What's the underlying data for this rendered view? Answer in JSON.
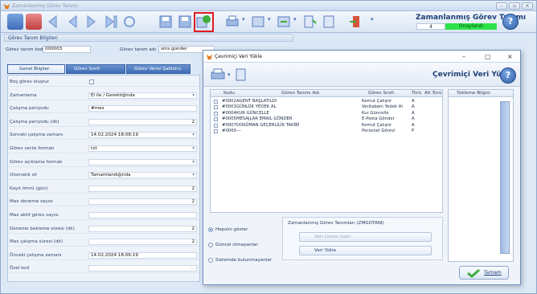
{
  "window": {
    "title": "Zamanlanmış Görev Tanımı",
    "app_title": "Zamanlanmış Görev Tanımı",
    "status_number": "4",
    "status_label": "Onaylandı",
    "help": "?",
    "controls": [
      "minimize-icon",
      "maximize-icon",
      "close-icon"
    ]
  },
  "toolbar": {
    "icons": [
      "first-record-icon",
      "prev-record-icon",
      "prev-icon",
      "next-icon",
      "next-record-icon",
      "last-record-icon",
      "refresh-icon",
      "save-icon",
      "save-as-icon",
      "load-data-icon",
      "print-icon",
      "export-icon",
      "import-icon",
      "attach-icon",
      "exit-icon"
    ]
  },
  "section": {
    "header": "Görev Tanım Bilgileri"
  },
  "header_fields": {
    "code_label": "Görev tanım kodu",
    "code_value": "000003",
    "name_label": "Görev tanım adı",
    "name_value": "sms gonder"
  },
  "tabs": [
    "Genel Bilgiler",
    "Görev Sınıfı Bilgileri",
    "Görev Verisi Şablonu"
  ],
  "form": [
    {
      "label": "Boş görev oluştur",
      "value": "",
      "type": "checkbox"
    },
    {
      "label": "Zamanlama",
      "value": "El ile / Gerektiğinde",
      "type": "select"
    },
    {
      "label": "Çalışma periyodu",
      "value": "#mes",
      "type": "text"
    },
    {
      "label": "Çalışma periyodu (dk)",
      "value": "2",
      "type": "number"
    },
    {
      "label": "Sonraki çalışma zamanı",
      "value": "14.02.2024 18:08:19",
      "type": "select"
    },
    {
      "label": "Görev verisi formatı",
      "value": "txt",
      "type": "select"
    },
    {
      "label": "Görev açıklama formatı",
      "value": "",
      "type": "select"
    },
    {
      "label": "Otomatik sil",
      "value": "Tamamlandığında",
      "type": "select"
    },
    {
      "label": "Kayıt ömrü (gün)",
      "value": "2",
      "type": "number"
    },
    {
      "label": "Max deneme sayısı",
      "value": "2",
      "type": "number"
    },
    {
      "label": "Max aktif görev sayısı",
      "value": "",
      "type": "number"
    },
    {
      "label": "Deneme bekleme süresi (dk)",
      "value": "2",
      "type": "number"
    },
    {
      "label": "Max çalışma süresi (dk)",
      "value": "2",
      "type": "number"
    },
    {
      "label": "Önceki çalışma zamanı",
      "value": "14.02.2024 18:06:19",
      "type": "text"
    },
    {
      "label": "Özel kod",
      "value": "",
      "type": "lookup"
    }
  ],
  "dialog": {
    "title": "Çevrimiçi Veri Yükle",
    "app_title": "Çevrimiçi Veri Yükle",
    "help": "?",
    "controls": [
      "minimize-icon",
      "maximize-icon",
      "close-icon"
    ],
    "columns": [
      "Kodu",
      "Gören Tanımı Adı",
      "Görev Sınıfı",
      "Türü",
      "Alt Türü"
    ],
    "rows": [
      [
        "#0002",
        "AGENT BAŞLATILDI",
        "Komut Çalıştır",
        "A",
        ""
      ],
      [
        "#0003",
        "GÜNLÜK YEDEK AL",
        "Veritabanı Yedek Al",
        "A",
        ""
      ],
      [
        "#0004",
        "KUR GÜNCELLE",
        "Kur Güncelle",
        "A",
        ""
      ],
      [
        "#0005",
        "MESAJLAR EMAIL GÖNDER",
        "E-Posta Gönder",
        "A",
        ""
      ],
      [
        "#0007",
        "DOKÜMAN GEÇERLİLİK TAKİBİ",
        "Komut Çalıştır",
        "A",
        ""
      ],
      [
        "#0000",
        "---",
        "Personel Görevi",
        "P",
        ""
      ]
    ],
    "load_info_header": "Yükleme Bilgisi",
    "radios": [
      {
        "label": "Hepsini göster",
        "selected": true
      },
      {
        "label": "Güncel olmayanlar",
        "selected": false
      },
      {
        "label": "Sistemde bulunmayanlar",
        "selected": false
      }
    ],
    "group_title": "Zamanlanmış Görev Tanımları (ZMGOTANI)",
    "btn_list": "Veri Listesi Getir",
    "btn_load": "Veri Yükle",
    "ok_label": "Tamam"
  }
}
